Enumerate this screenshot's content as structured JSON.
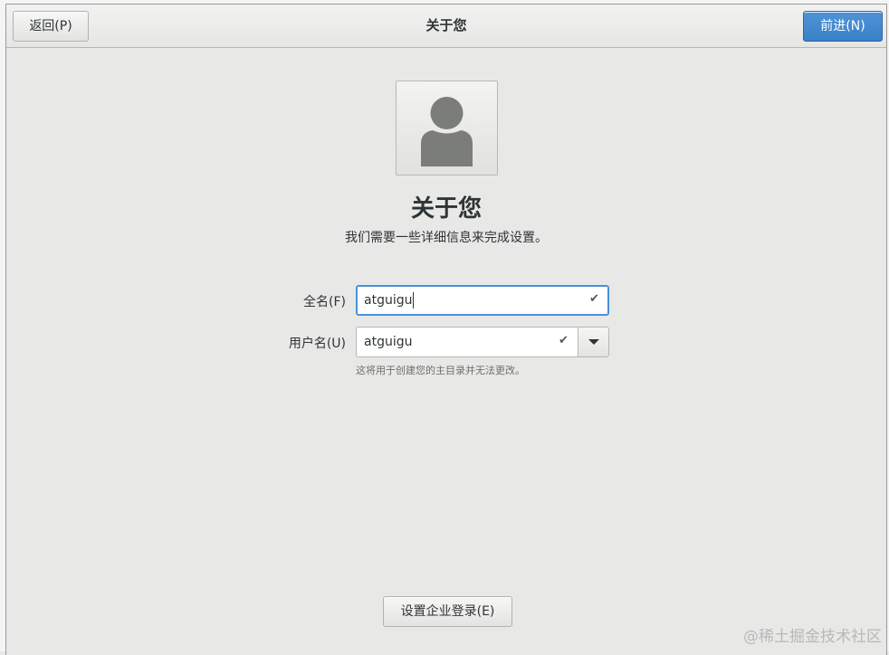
{
  "header": {
    "title": "关于您",
    "back_label": "返回(P)",
    "next_label": "前进(N)"
  },
  "main": {
    "title": "关于您",
    "subtitle": "我们需要一些详细信息来完成设置。",
    "full_name": {
      "label": "全名(F)",
      "value": "atguigu"
    },
    "username": {
      "label": "用户名(U)",
      "value": "atguigu",
      "hint": "这将用于创建您的主目录并无法更改。"
    },
    "enterprise_button": "设置企业登录(E)"
  },
  "icons": {
    "avatar": "user-avatar-icon",
    "check": "checkmark-icon",
    "dropdown": "chevron-down-icon"
  },
  "colors": {
    "accent": "#4a90d9",
    "background": "#e8e8e7"
  },
  "watermark": "@稀土掘金技术社区"
}
